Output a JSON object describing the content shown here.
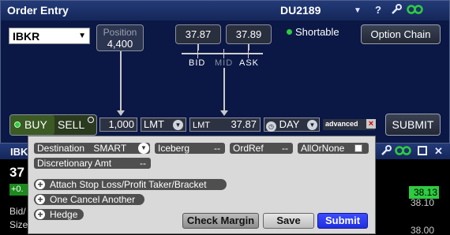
{
  "order_entry": {
    "title": "Order Entry",
    "account": "DU2189",
    "toolbar_icons": [
      "dropdown-icon",
      "help-icon",
      "wrench-icon",
      "link-icon"
    ],
    "help_glyph": "?",
    "symbol": "IBKR",
    "position": {
      "label": "Position",
      "value": "4,400"
    },
    "bid": "37.87",
    "ask": "37.89",
    "scale_labels": {
      "bid": "BID",
      "mid": "MID",
      "ask": "ASK"
    },
    "shortable": "Shortable",
    "option_chain": "Option Chain",
    "buy": "BUY",
    "sell": "SELL",
    "quantity": "1,000",
    "order_type": "LMT",
    "limit_label": "LMT",
    "limit_price": "37.87",
    "tif": "DAY",
    "advanced": "advanced",
    "close_glyph": "×",
    "submit": "SUBMIT"
  },
  "advanced_panel": {
    "destination_label": "Destination",
    "destination_value": "SMART",
    "iceberg_label": "Iceberg",
    "iceberg_value": "--",
    "ordref_label": "OrdRef",
    "ordref_value": "--",
    "allornone_label": "AllOrNone",
    "discretionary_label": "Discretionary Amt",
    "discretionary_value": "--",
    "attach_stop": "Attach Stop Loss/Profit Taker/Bracket",
    "oca": "One Cancel Another",
    "hedge": "Hedge",
    "check_margin": "Check Margin",
    "save": "Save",
    "submit": "Submit"
  },
  "background_window": {
    "symbol": "IBK",
    "price": "37",
    "change": "+0.",
    "bid_label": "Bid/",
    "size_label": "Size",
    "ladder": [
      "38.13",
      "38.10",
      "38.00"
    ]
  },
  "colors": {
    "window_bg": "#0b1845",
    "title_bg": "#1a2f68",
    "buy_green": "#2ecc40",
    "submit_blue": "#1f2fe0",
    "close_red": "#d10000"
  }
}
